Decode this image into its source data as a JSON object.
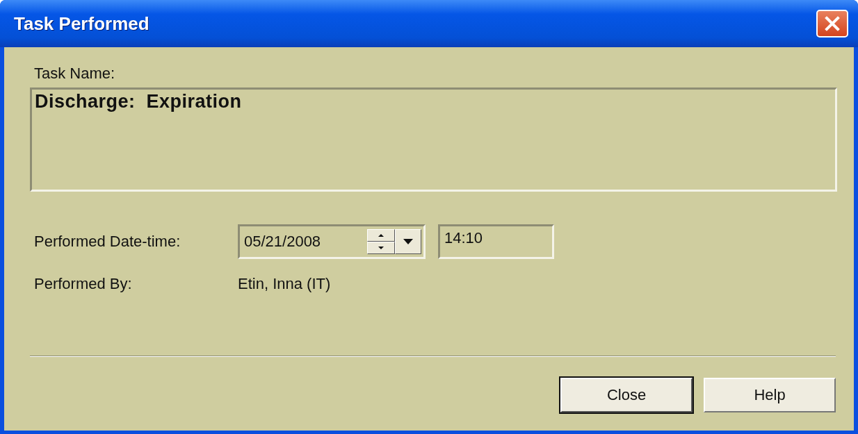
{
  "window": {
    "title": "Task Performed"
  },
  "task_name": {
    "label": "Task Name:",
    "value": "Discharge:  Expiration"
  },
  "performed_datetime": {
    "label": "Performed Date-time:",
    "date": "05/21/2008",
    "time": "14:10"
  },
  "performed_by": {
    "label": "Performed By:",
    "value": "Etin, Inna (IT)"
  },
  "buttons": [
    {
      "label": "Close",
      "default": true
    },
    {
      "label": "Help",
      "default": false
    }
  ]
}
